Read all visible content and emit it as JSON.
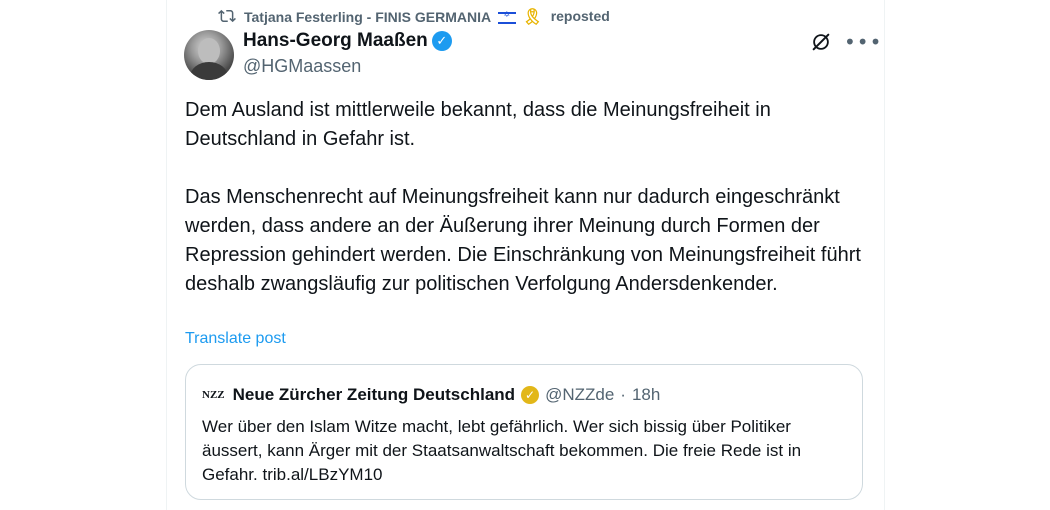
{
  "repost": {
    "reposter": "Tatjana Festerling - FINIS GERMANIA",
    "label": "reposted"
  },
  "author": {
    "name": "Hans-Georg Maaßen",
    "handle": "@HGMaassen"
  },
  "post": {
    "paragraphs": [
      "Dem Ausland ist mittlerweile bekannt, dass die Meinungsfreiheit in Deutschland in Gefahr ist.",
      "Das Menschenrecht auf Meinungsfreiheit kann nur dadurch eingeschränkt werden, dass andere an der Äußerung ihrer Meinung durch Formen der Repression gehindert werden. Die Einschränkung von Meinungsfreiheit führt deshalb zwangsläufig zur politischen Verfolgung Andersdenkender."
    ],
    "translate_label": "Translate post"
  },
  "quote": {
    "logo_text": "NZZ",
    "name": "Neue Zürcher Zeitung Deutschland",
    "handle": "@NZZde",
    "separator": "·",
    "time": "18h",
    "text": "Wer über den Islam Witze macht, lebt gefährlich. Wer sich bissig über Politiker äussert, kann Ärger mit der Staatsanwaltschaft bekommen. Die freie Rede ist in Gefahr. trib.al/LBzYM10"
  },
  "icons": {
    "repost": "repost-icon",
    "verified": "verified-badge-icon",
    "grok": "grok-icon",
    "more": "more-icon"
  },
  "colors": {
    "accent": "#1d9bf0",
    "secondary_text": "#536471",
    "gold_badge": "#e2b719"
  }
}
